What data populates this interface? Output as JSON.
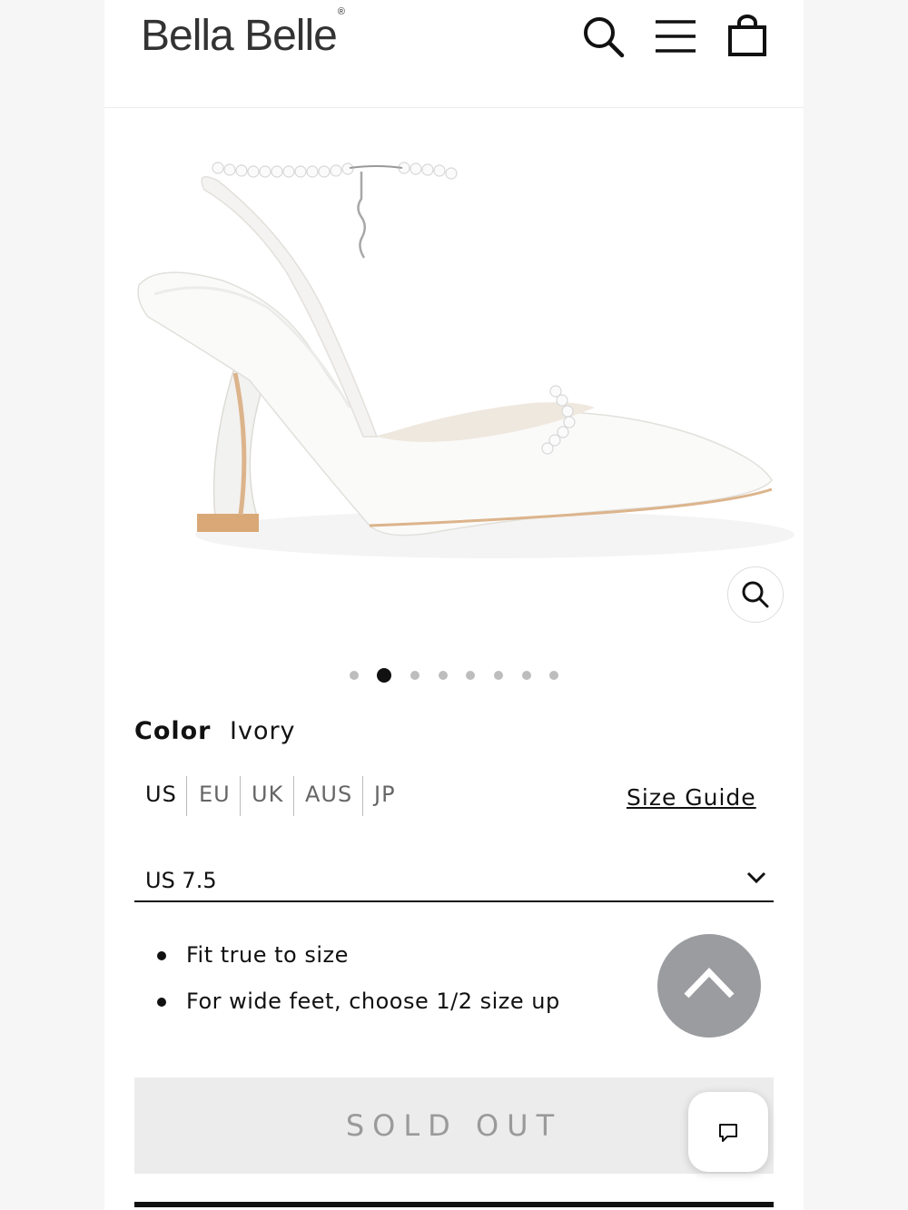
{
  "header": {
    "brand": "Bella Belle",
    "brand_mark": "®",
    "icons": [
      "search-icon",
      "menu-icon",
      "cart-icon"
    ]
  },
  "gallery": {
    "image": "white pointed-toe slingback heel with pearl ankle strap",
    "active_index": 2,
    "total": 8,
    "zoom_icon": "zoom-icon"
  },
  "color": {
    "label": "Color",
    "value": "Ivory"
  },
  "size": {
    "systems": [
      "US",
      "EU",
      "UK",
      "AUS",
      "JP"
    ],
    "active_system": "US",
    "guide_link": "Size Guide",
    "selected": "US 7.5"
  },
  "fit_notes": [
    "Fit true to size",
    "For wide feet, choose 1/2 size up"
  ],
  "buttons": {
    "sold_out": "SOLD OUT",
    "scroll_top_icon": "chevron-up-icon",
    "chat_icon": "chat-icon"
  }
}
